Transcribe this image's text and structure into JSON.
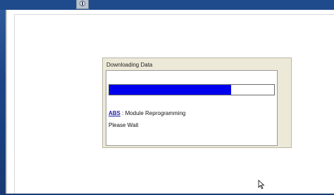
{
  "dialog": {
    "title": "Downloading Data",
    "progress_fraction": 0.74,
    "progress_color": "#0000ee",
    "module_code": "ABS",
    "module_separator": " : ",
    "module_description": "Module Reprogramming",
    "status_text": "Please Wait"
  },
  "icons": {
    "top_tab": "app-tab-icon",
    "cursor": "mouse-pointer-icon"
  }
}
